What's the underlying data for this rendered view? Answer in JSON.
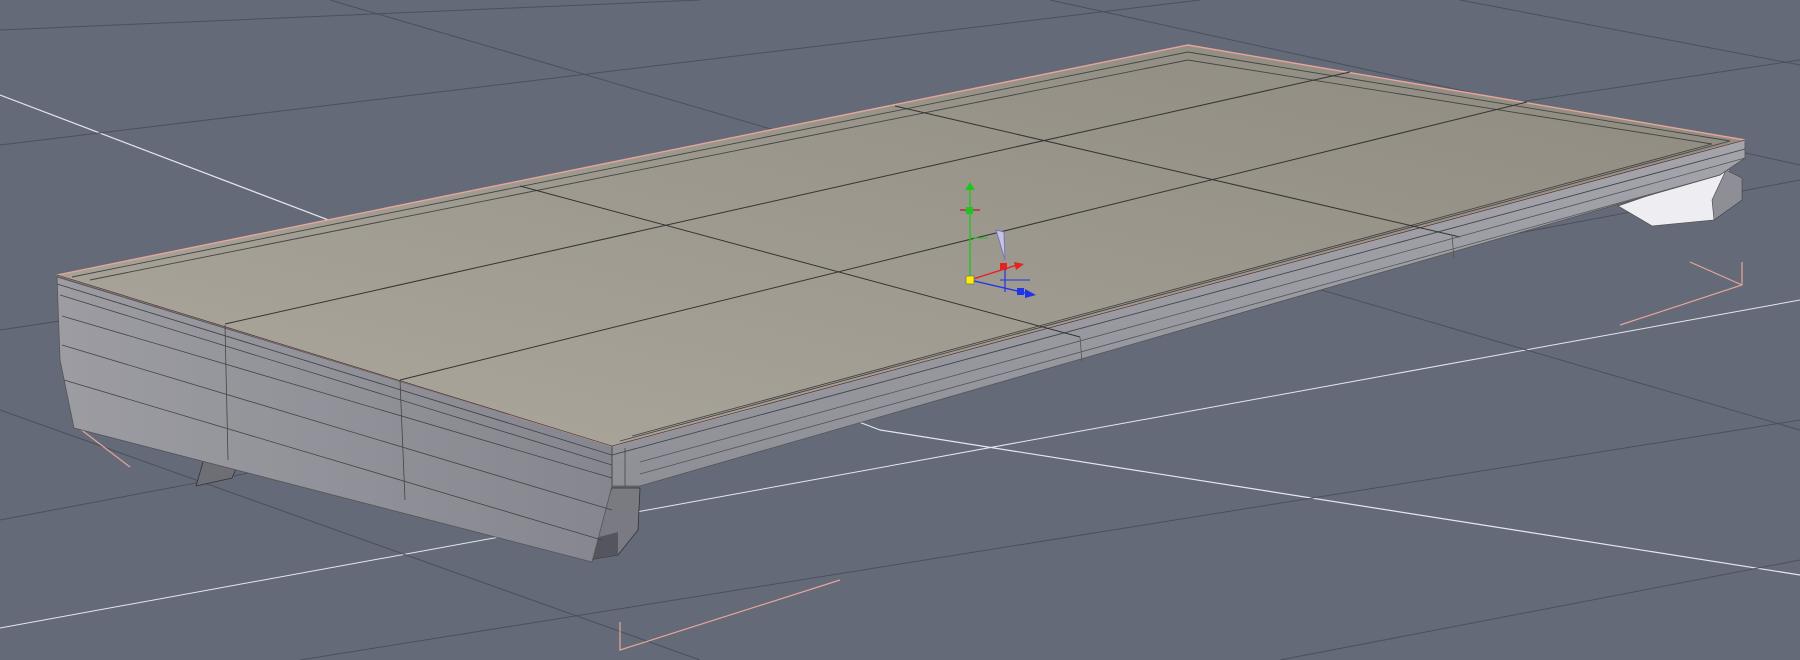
{
  "viewport": {
    "colors": {
      "background": "#646a78",
      "grid_major": "#e6e8ee",
      "grid_minor": "#4a505c",
      "tabletop": "#a39e92",
      "edge": "#8d8d98",
      "selection_outline": "#e7a59a",
      "axis_x": "#e32222",
      "axis_y": "#21c521",
      "axis_z": "#2233e6",
      "pivot": "#ffee00"
    },
    "gizmo_icons": [
      "move-y-arrow-icon",
      "move-x-arrow-icon",
      "move-z-arrow-icon",
      "pivot-point-icon",
      "rotate-handle-icon"
    ]
  }
}
